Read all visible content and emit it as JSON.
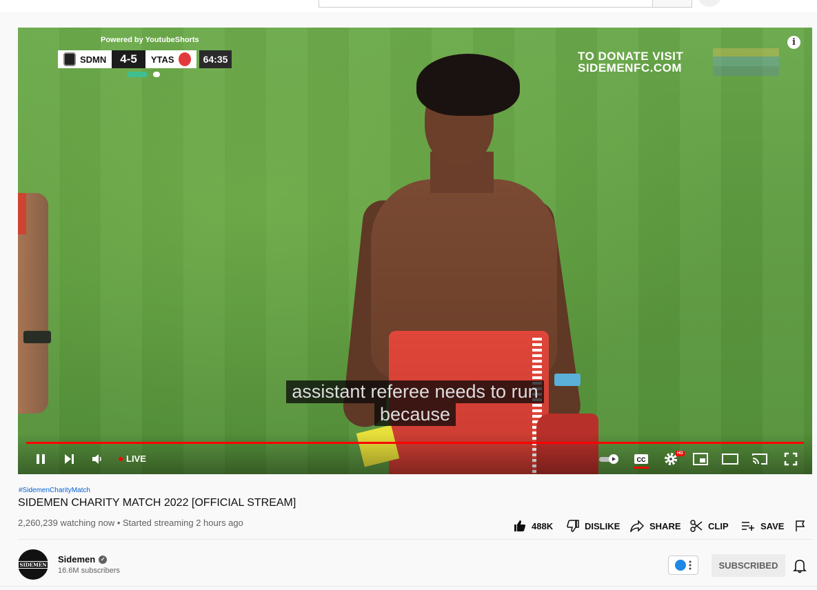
{
  "player": {
    "powered_by": "Powered by YoutubeShorts",
    "scorebug": {
      "home_team": "SDMN",
      "score": "4-5",
      "away_team": "YTAS",
      "clock": "64:35"
    },
    "donate_line1": "TO DONATE VISIT",
    "donate_line2": "SIDEMENFC.COM",
    "caption_line1": "assistant referee needs to run",
    "caption_line2": "because",
    "live_label": "LIVE",
    "hd_badge": "HD",
    "info_icon": "i",
    "progress_fraction": 1.0
  },
  "video": {
    "hashtag": "#SidemenCharityMatch",
    "title": "SIDEMEN CHARITY MATCH 2022 [OFFICIAL STREAM]",
    "meta": "2,260,239 watching now • Started streaming 2 hours ago"
  },
  "actions": {
    "like_count": "488K",
    "dislike_label": "DISLIKE",
    "share_label": "SHARE",
    "clip_label": "CLIP",
    "save_label": "SAVE"
  },
  "channel": {
    "name": "Sidemen",
    "avatar_text": "SIDEMEN",
    "subscribers": "16.6M subscribers",
    "subscribe_label": "SUBSCRIBED"
  },
  "colors": {
    "progress": "#ff0000",
    "link": "#065fd4",
    "pitch": "#5e9c40"
  },
  "icons": [
    "pause-icon",
    "next-icon",
    "volume-icon",
    "autoplay-toggle-icon",
    "captions-icon",
    "settings-icon",
    "miniplayer-icon",
    "theater-mode-icon",
    "cast-icon",
    "fullscreen-icon",
    "thumbs-up-icon",
    "thumbs-down-icon",
    "share-icon",
    "scissors-icon",
    "playlist-add-icon",
    "flag-icon",
    "bell-icon",
    "verified-icon"
  ]
}
